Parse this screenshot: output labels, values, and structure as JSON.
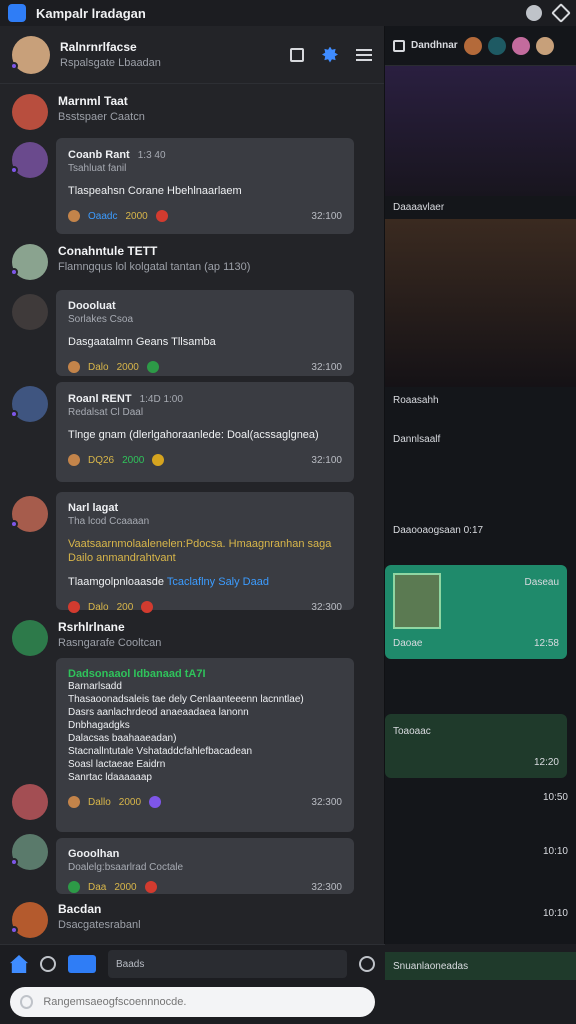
{
  "window": {
    "title": "Kampalr lradagan"
  },
  "left_header": {
    "name": "Ralnrnrlfacse",
    "sub": "Rspalsgate Lbaadan"
  },
  "feed": [
    {
      "name": "Marnml Taat",
      "sub": "Bsstspaer Caatcn",
      "type": "entry"
    },
    {
      "name": "Coanb Rant",
      "sub": "Tsahluat fanil",
      "time_inline": "1:3 40",
      "text": "Tlaspeahsn Corane Hbehlnaarlaem",
      "reactions": [
        "Oaadc",
        "2000"
      ],
      "time": "32:100",
      "type": "card"
    },
    {
      "name": "Conahntule TETT",
      "sub": "Flamngqus lol kolgatal tantan (ap 1130)",
      "type": "entry"
    },
    {
      "name": "Doooluat",
      "sub": "Sorlakes Csoa",
      "text": "Dasgaatalmn Geans Tllsamba",
      "reactions": [
        "Dalo",
        "2000"
      ],
      "time": "32:100",
      "type": "card"
    },
    {
      "name": "Roanl RENT",
      "sub": "Redalsat Cl Daal",
      "time_inline": "1:4D 1:00",
      "text": "Tlnge gnam (dlerlgahoraanlede: Doal(acssaglgnea)",
      "reactions": [
        "DQ26",
        "2000"
      ],
      "time": "32:100",
      "type": "card"
    },
    {
      "name": "Narl lagat",
      "sub": "Tha lcod Ccaaaan",
      "yellow": "Vaatsaarnmolaalenelen:Pdocsa. Hmaagnranhan saga Dailo anmandrahtvant",
      "text2": "Tlaamgolpnloaasde",
      "blue": "Tcaclaflny Saly Daad",
      "reactions": [
        "Dalo",
        "200"
      ],
      "time": "32:300",
      "type": "card"
    },
    {
      "name": "Rsrhlrlnane",
      "sub": "Rasngarafe Cooltcan",
      "green": "Dadsonaaol Idbanaad tA7I",
      "list": [
        "Barnarlsadd",
        "Thasaoonadsaleis tae dely Cenlaanteeenn lacnntlae)",
        "Dasrs aanlachrdeod anaeaadaea lanonn",
        "Dnbhagadgks",
        "Dalacsas baahaaeadan)",
        "Stacnallntutale Vshataddcfahlefbacadean",
        "Soasl lactaeae Eaidrn"
      ],
      "blue2": "Sanrtac ldaaaaaap",
      "reactions": [
        "Dallo",
        "2000"
      ],
      "time": "32:300",
      "type": "card"
    },
    {
      "name": "Gooolhan",
      "sub": "Doalelg:bsaarlrad Coctale",
      "reactions": [
        "Daa",
        "2000"
      ],
      "time": "32:300",
      "type": "card"
    },
    {
      "name": "Bacdan",
      "sub": "Dsacgatesrabanl",
      "type": "entry"
    }
  ],
  "bottom": {
    "draft": "Baads",
    "composer_placeholder": "Rangemsaeogfscoennnocde."
  },
  "right": {
    "header": "Dandhnar",
    "tabs": "Daaaavlaer",
    "labels": [
      "Roaasahh",
      "Dannlsaalf",
      "Daaooaogsaan 0:17"
    ],
    "card1": {
      "name": "Daseau",
      "sub": "Daoae",
      "time": "12:58"
    },
    "card2": {
      "title": "Toaoaac",
      "time": "12:20"
    },
    "times": [
      "10:50",
      "10:10",
      "10:10"
    ],
    "bottom": "Snuanlaoneadas"
  }
}
